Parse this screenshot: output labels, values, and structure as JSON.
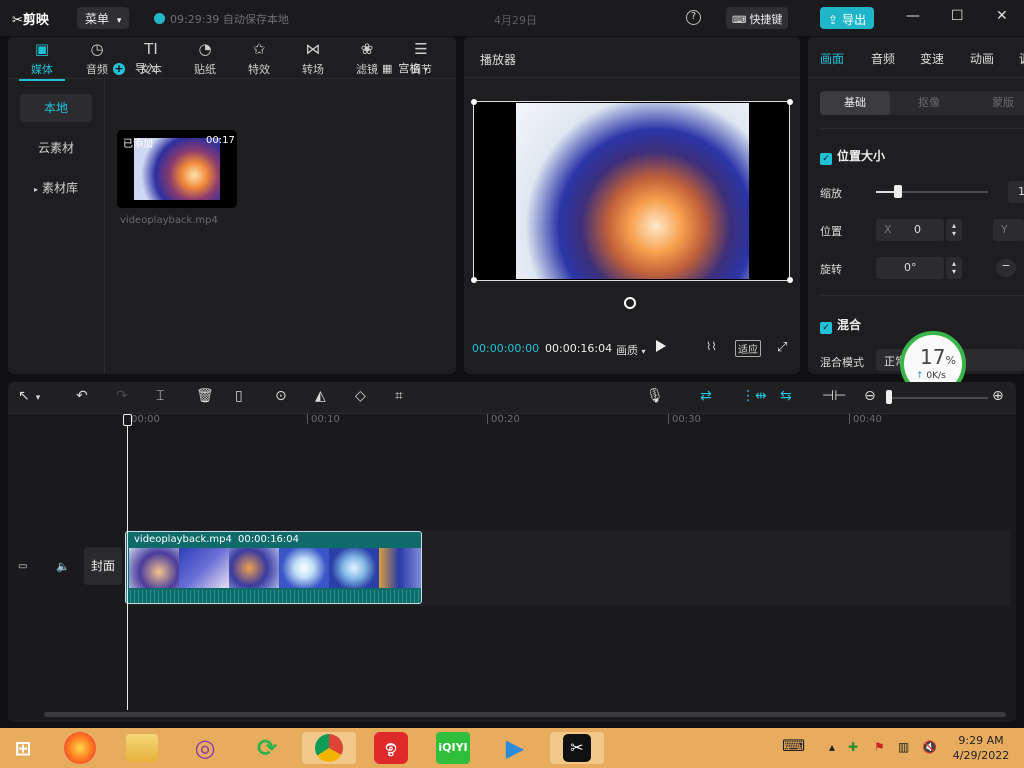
{
  "app": {
    "logo": "✂剪映",
    "menu_label": "菜单",
    "autosave_text": "09:29:39 自动保存本地",
    "project_title": "4月29日",
    "shortcut_label": "快捷键",
    "export_label": "导出",
    "accent_color": "#20c1d6"
  },
  "media": {
    "tools": [
      {
        "icon": "media-icon",
        "label": "媒体"
      },
      {
        "icon": "audio-icon",
        "label": "音频"
      },
      {
        "icon": "text-icon",
        "label": "文本"
      },
      {
        "icon": "sticker-icon",
        "label": "贴纸"
      },
      {
        "icon": "effects-icon",
        "label": "特效"
      },
      {
        "icon": "transition-icon",
        "label": "转场"
      },
      {
        "icon": "filter-icon",
        "label": "滤镜"
      },
      {
        "icon": "adjust-icon",
        "label": "调节"
      }
    ],
    "side": [
      "本地",
      "云素材",
      "素材库"
    ],
    "import_label": "导入",
    "view_label": "宫格",
    "item": {
      "tag": "已添加",
      "duration": "00:17",
      "filename": "videoplayback.mp4"
    }
  },
  "player": {
    "title": "播放器",
    "current_time": "00:00:00:00",
    "total_time": "00:00:16:04",
    "quality_label": "画质",
    "fit_label": "适应"
  },
  "inspector": {
    "tabs": [
      "画面",
      "音频",
      "变速",
      "动画",
      "调"
    ],
    "subtabs": [
      "基础",
      "抠像",
      "蒙版"
    ],
    "section_position": "位置大小",
    "scale_label": "缩放",
    "scale_value": "1",
    "position_label": "位置",
    "x_label": "X",
    "x_value": "0",
    "y_label": "Y",
    "rotate_label": "旋转",
    "rotate_value": "0°",
    "section_blend": "混合",
    "blend_mode_label": "混合模式",
    "blend_mode_value": "正常"
  },
  "net_monitor": {
    "percent": "17",
    "percent_sign": "%",
    "speed": "0K/s"
  },
  "timeline": {
    "ruler": [
      "00:00",
      "00:10",
      "00:20",
      "00:30",
      "00:40"
    ],
    "cover_label": "封面",
    "clip_name": "videoplayback.mp4",
    "clip_duration": "00:00:16:04"
  },
  "taskbar": {
    "time": "9:29 AM",
    "date": "4/29/2022"
  }
}
